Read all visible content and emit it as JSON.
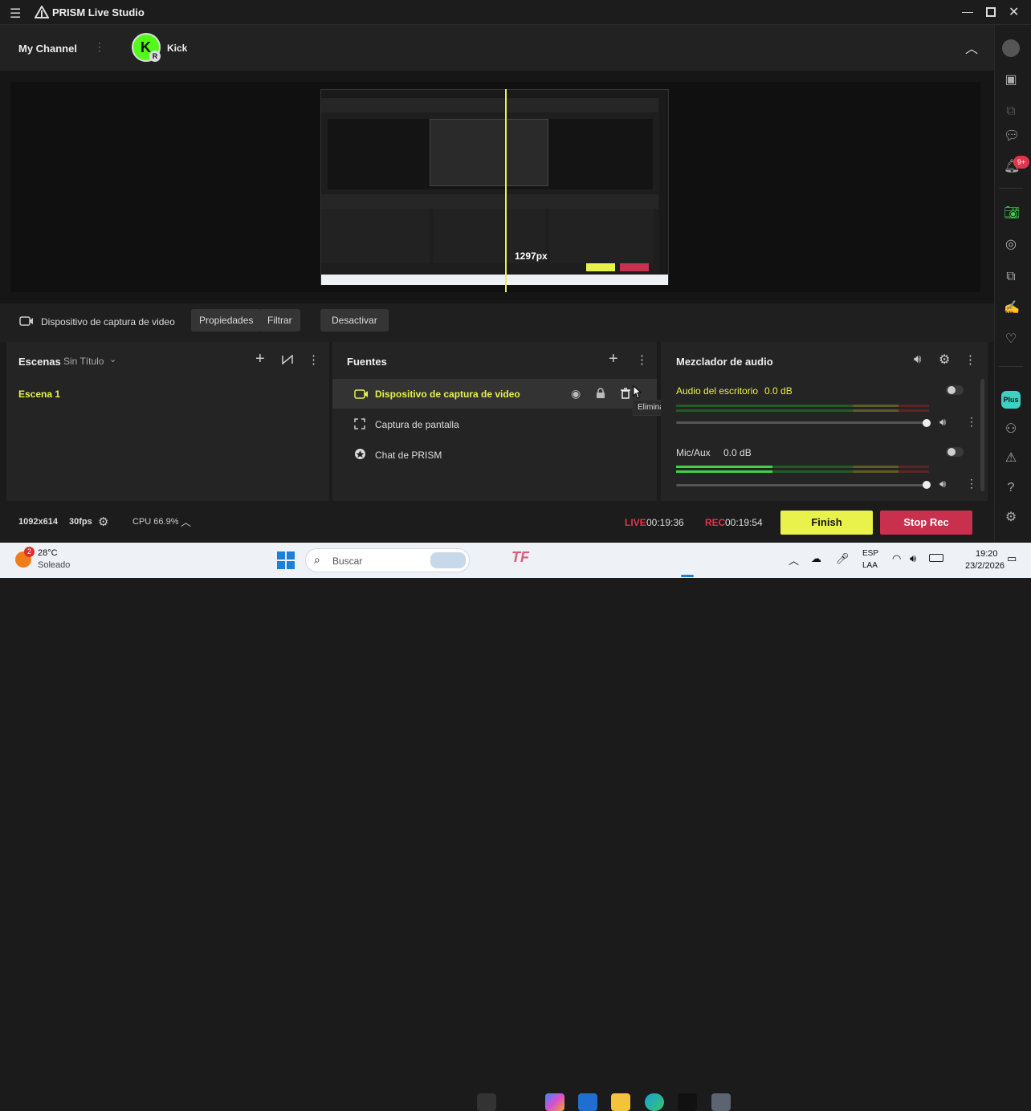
{
  "app": {
    "title": "PRISM Live Studio"
  },
  "channel": {
    "name": "My Channel",
    "platform": "Kick",
    "avatar_letter": "K",
    "badge": "R"
  },
  "preview": {
    "overlay_text": "1297px"
  },
  "source_bar": {
    "selected_source": "Dispositivo de captura de video",
    "buttons": [
      "Propiedades",
      "Filtrar",
      "Desactivar"
    ]
  },
  "scenes": {
    "title": "Escenas",
    "collection": "Sin Título",
    "items": [
      "Escena 1"
    ]
  },
  "sources": {
    "title": "Fuentes",
    "items": [
      {
        "name": "Dispositivo de captura de video",
        "icon": "camera-icon"
      },
      {
        "name": "Captura de pantalla",
        "icon": "fullscreen-icon"
      },
      {
        "name": "Chat de PRISM",
        "icon": "chat-icon"
      }
    ],
    "tooltip": "Eliminar fuente"
  },
  "mixer": {
    "title": "Mezclador de audio",
    "tracks": [
      {
        "name": "Audio del escritorio",
        "db": "0.0 dB",
        "level": 0
      },
      {
        "name": "Mic/Aux",
        "db": "0.0 dB",
        "level": 0.38
      }
    ]
  },
  "status": {
    "resolution": "1092x614",
    "fps": "30fps",
    "cpu": "CPU 66.9%",
    "live_label": "LIVE",
    "live_time": "00:19:36",
    "rec_label": "REC",
    "rec_time": "00:19:54",
    "finish": "Finish",
    "stop_rec": "Stop Rec"
  },
  "rightbar": {
    "notif_badge": "9+",
    "plus_label": "Plus"
  },
  "taskbar": {
    "weather_temp": "28°C",
    "weather_desc": "Soleado",
    "weather_badge": "2",
    "search": "Buscar",
    "lang1": "ESP",
    "lang2": "LAA",
    "time": "19:20",
    "date": "23/2/2026"
  },
  "colors": {
    "accent_yellow": "#e8f24a",
    "green": "#3fd14a",
    "red": "#c9304e",
    "live_red": "#e0344d"
  }
}
